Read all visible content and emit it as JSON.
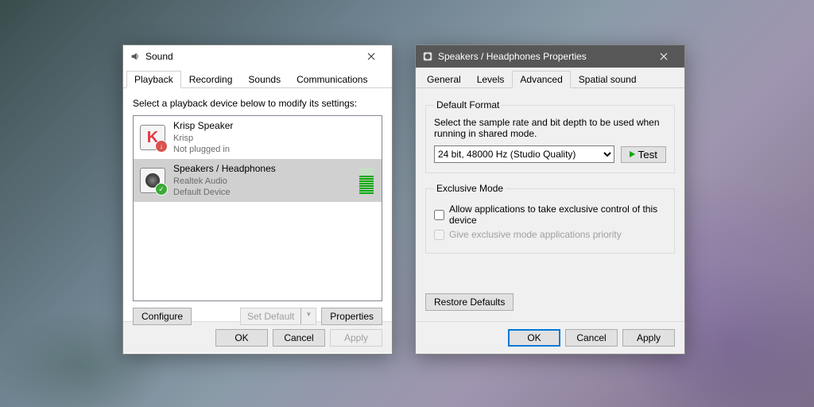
{
  "sound": {
    "title": "Sound",
    "tabs": [
      "Playback",
      "Recording",
      "Sounds",
      "Communications"
    ],
    "active_tab": 0,
    "instruction": "Select a playback device below to modify its settings:",
    "devices": [
      {
        "name": "Krisp Speaker",
        "line2": "Krisp",
        "line3": "Not plugged in",
        "icon": "krisp",
        "badge": "down",
        "selected": false,
        "meter": false
      },
      {
        "name": "Speakers / Headphones",
        "line2": "Realtek Audio",
        "line3": "Default Device",
        "icon": "speaker",
        "badge": "check",
        "selected": true,
        "meter": true
      }
    ],
    "configure": "Configure",
    "set_default": "Set Default",
    "properties": "Properties",
    "ok": "OK",
    "cancel": "Cancel",
    "apply": "Apply"
  },
  "props": {
    "title": "Speakers / Headphones Properties",
    "tabs": [
      "General",
      "Levels",
      "Advanced",
      "Spatial sound"
    ],
    "active_tab": 2,
    "default_format": {
      "legend": "Default Format",
      "desc": "Select the sample rate and bit depth to be used when running in shared mode.",
      "value": "24 bit, 48000 Hz (Studio Quality)",
      "test": "Test"
    },
    "exclusive": {
      "legend": "Exclusive Mode",
      "opt1": "Allow applications to take exclusive control of this device",
      "opt2": "Give exclusive mode applications priority"
    },
    "restore": "Restore Defaults",
    "ok": "OK",
    "cancel": "Cancel",
    "apply": "Apply"
  }
}
